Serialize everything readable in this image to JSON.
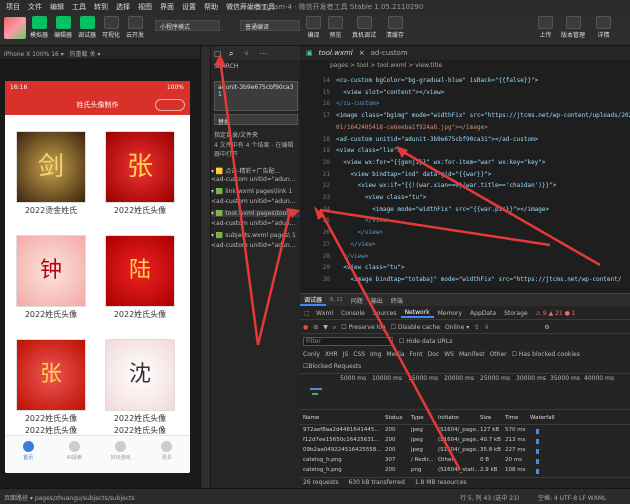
{
  "menubar": {
    "items": [
      "项目",
      "文件",
      "编辑",
      "工具",
      "转到",
      "选择",
      "视图",
      "界面",
      "设置",
      "帮助",
      "微信开发者工具"
    ],
    "title": "miniprogram-4 · 微信开发者工具 Stable 1.05.2110290"
  },
  "toolbar": {
    "left_buttons": [
      "模拟器",
      "编辑器",
      "调试器",
      "可视化",
      "云开发"
    ],
    "mode_select": "小程序模式",
    "compile_select": "普通编译",
    "right_buttons": [
      "上传",
      "版本管理",
      "详情"
    ],
    "mid_labels": [
      "编译",
      "预览",
      "真机调试",
      "清缓存"
    ]
  },
  "simulator": {
    "device": "iPhone X 100% 16 ▾",
    "hotreload": "热重载 关 ▾",
    "status_time": "16:16",
    "status_batt": "100%",
    "nav_title": "姓氏头像制作",
    "cards": [
      {
        "caption": "2022烫金姓氏",
        "art": "剑"
      },
      {
        "caption": "2022姓氏头像",
        "art": "张"
      },
      {
        "caption": "2022姓氏头像",
        "art": "钟"
      },
      {
        "caption": "2022姓氏头像",
        "art": "陆"
      },
      {
        "caption": "2022姓氏头像",
        "art": "张"
      },
      {
        "caption": "2022姓氏头像",
        "art": "沈"
      }
    ],
    "bottom_caps": [
      "2022姓氏头像",
      "2022姓氏头像"
    ],
    "tabs": [
      "首页",
      "AI探索",
      "好玩游戏",
      "更多"
    ]
  },
  "explorer": {
    "search_label": "SEARCH",
    "query": "adunit-3b9e675cbf90ca31",
    "replace_label": "替换",
    "files_label": "指定目录/文件夹",
    "summary": "4 文件中有 4 个结果 - 在编辑器中打开",
    "results": [
      "▾ 🟨 点击-精彩+广告配...",
      "  <ad-custom unitid=\"adun...",
      "▾ 🟩 link.wxml pages\\link 1",
      "  <ad-custom unitid=\"adun...",
      "▾ 🟩 tool.wxml pages\\tool 1",
      "  <ad-custom unitid=\"adun...",
      "▾ 🟩 subjects.wxml pages\\ 1",
      "  <ad-custom unitid=\"adun..."
    ]
  },
  "editor": {
    "tab": "tool.wxml",
    "tab2": "ad-custom",
    "breadcrumb": "pages > tool > tool.wxml > view.title",
    "lines": [
      {
        "n": "14",
        "code": "<cu-custom bgColor=\"bg-gradual-blue\" isBack=\"{{false}}\">"
      },
      {
        "n": "15",
        "code": "  <view slot=\"content\"></view>"
      },
      {
        "n": "16",
        "code": "</cu-custom>"
      },
      {
        "n": "17",
        "code": "<image class=\"bgimg\" mode=\"widthFix\" src=\"https://jtcms.net/wp-content/uploads/2022/"
      },
      {
        "n": "",
        "code": "01/1642405418-ce6eeba1f924a8.jpg\"></image>"
      },
      {
        "n": "18",
        "code": "<ad-custom unitid=\"adunit-3b9e675cbf90ca31\"></ad-custom>"
      },
      {
        "n": "19",
        "code": "<view class=\"lie\">"
      },
      {
        "n": "20",
        "code": "  <view wx:for=\"{{genji}}\" wx:for-item=\"war\" wx:key=\"key\">"
      },
      {
        "n": "21",
        "code": "    <view bindtap=\"ind\" data-gid=\"{{war}}\">"
      },
      {
        "n": "22",
        "code": "      <view wx:if=\"{{!(war.xian==0||war.title=='chaidan')}}\">"
      },
      {
        "n": "23",
        "code": "        <view class=\"tu\">"
      },
      {
        "n": "24",
        "code": "          <image mode=\"widthFix\" src=\"{{war.pic}}\"></image>"
      },
      {
        "n": "25",
        "code": "        </view>"
      },
      {
        "n": "26",
        "code": "      </view>"
      },
      {
        "n": "27",
        "code": "    </view>"
      },
      {
        "n": "28",
        "code": "  </view>"
      },
      {
        "n": "29",
        "code": "  <view class=\"tu\">"
      },
      {
        "n": "30",
        "code": "    <image bindtap=\"totabaj\" mode=\"widthFix\" src=\"https://jtcms.net/wp-content/"
      }
    ]
  },
  "devtools": {
    "panel_tabs": [
      "调试器",
      "8, 21",
      "问题",
      "输出",
      "终端"
    ],
    "tabs": [
      "Wxml",
      "Console",
      "Sources",
      "Network",
      "Memory",
      "AppData",
      "Storage"
    ],
    "counts": "⚠ 9  ▲ 21  ● 1",
    "options": [
      "Preserve log",
      "Disable cache",
      "Online ▾"
    ],
    "filter_placeholder": "Filter",
    "hide_data_urls": "Hide data URLs",
    "types": [
      "Conly",
      "XHR",
      "JS",
      "CSS",
      "Img",
      "Media",
      "Font",
      "Doc",
      "WS",
      "Manifest",
      "Other"
    ],
    "has_blocked": "Has blocked cookies",
    "blocked_requests": "Blocked Requests",
    "timeline": [
      "5000 ms",
      "10000 ms",
      "15000 ms",
      "20000 ms",
      "25000 ms",
      "30000 ms",
      "35000 ms",
      "40000 ms",
      "45000 ms"
    ],
    "columns": [
      "Name",
      "Status",
      "Type",
      "Initiator",
      "Size",
      "Time",
      "Waterfall"
    ],
    "rows": [
      {
        "name": "972aef8aa2d4481641445...",
        "status": "200",
        "type": "jpeg",
        "init": "(S1604/_page...",
        "size": "127 kB",
        "time": "570 ms"
      },
      {
        "name": "f12d7ee15650c16425631...",
        "status": "200",
        "type": "jpeg",
        "init": "(S1604/_page...",
        "size": "40.7 kB",
        "time": "213 ms"
      },
      {
        "name": "09b2ae049224516425558...",
        "status": "200",
        "type": "jpeg",
        "init": "(S1604/_page...",
        "size": "35.8 kB",
        "time": "227 ms"
      },
      {
        "name": "catelog_h.png",
        "status": "307",
        "type": "/ Redir...",
        "init": "Other",
        "size": "0 B",
        "time": "20 ms"
      },
      {
        "name": "catelog_h.png",
        "status": "200",
        "type": "png",
        "init": "(S1604/_stati...",
        "size": "2.9 kB",
        "time": "108 ms"
      }
    ],
    "footer": [
      "26 requests",
      "630 kB transferred",
      "1.8 MB resources"
    ]
  },
  "bottombar": {
    "path": "页面路径 ▾  pages/zhuangu/subjects/subjects",
    "pos": "行 5, 列 43 (选中 23)",
    "enc": "空格: 4  UTF-8  LF  WXML"
  }
}
